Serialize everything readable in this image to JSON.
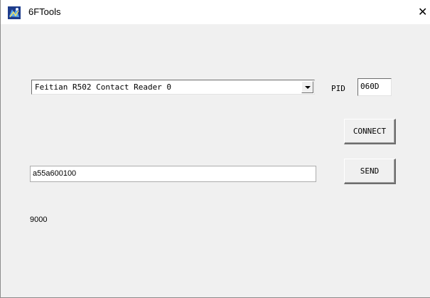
{
  "window": {
    "title": "6FTools",
    "close_glyph": "✕"
  },
  "reader": {
    "selected": "Feitian R502 Contact Reader 0"
  },
  "pid": {
    "label": "PID",
    "value": "060D"
  },
  "buttons": {
    "connect": "CONNECT",
    "send": "SEND"
  },
  "command": {
    "value": "a55a600100"
  },
  "response": {
    "text": "9000"
  }
}
